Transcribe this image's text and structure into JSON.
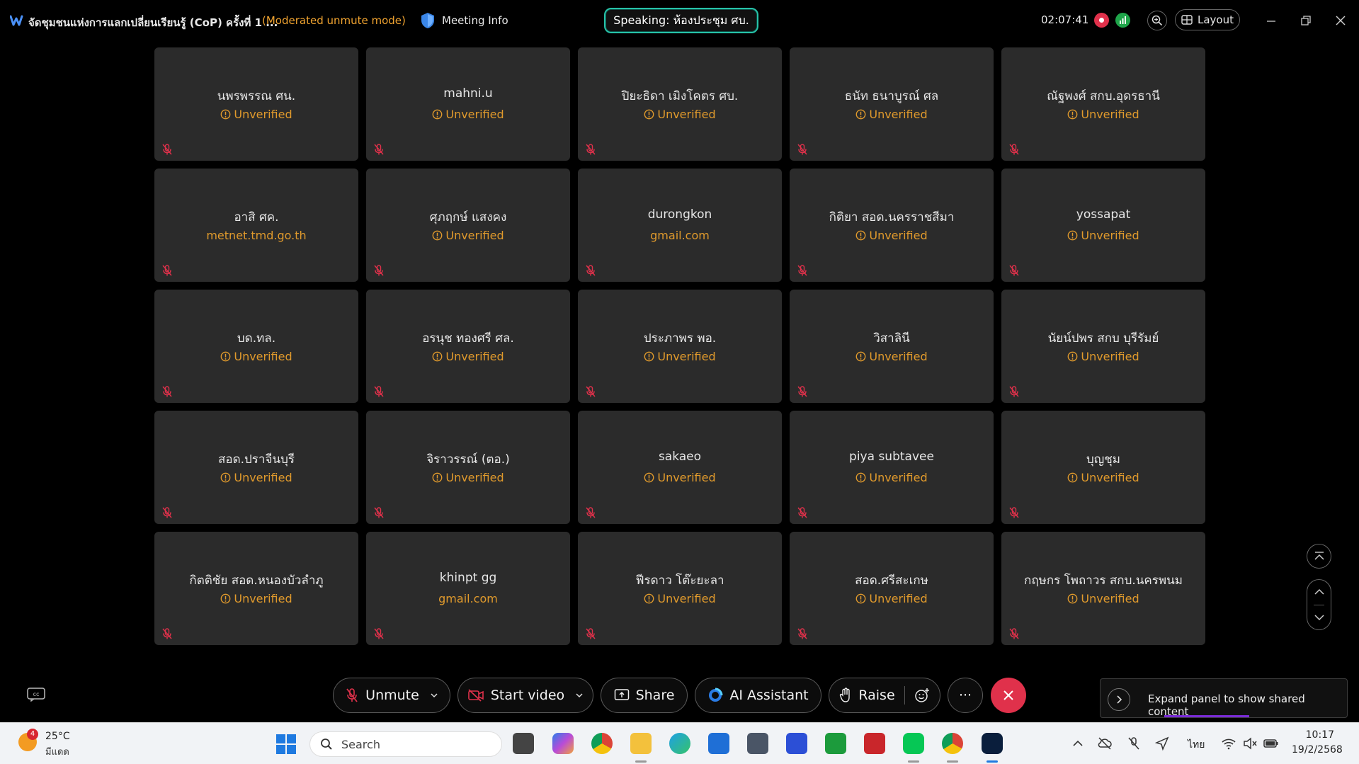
{
  "titlebar": {
    "meeting_title": "จัดชุมชนแห่งการแลกเปลี่ยนเรียนรู้ (CoP) ครั้งที่ 1 ...",
    "moderated": "(Moderated unmute mode)",
    "meeting_info": "Meeting Info",
    "speaking": "Speaking: ห้องประชุม ศบ.",
    "clock": "02:07:41",
    "layout": "Layout"
  },
  "participants": [
    {
      "name": "นพรพรรณ ศน.",
      "status": "Unverified",
      "verified_icon": true
    },
    {
      "name": "mahni.u",
      "status": "Unverified",
      "verified_icon": true
    },
    {
      "name": "ปิยะธิดา เมิงโคตร ศบ.",
      "status": "Unverified",
      "verified_icon": true
    },
    {
      "name": "ธนัท ธนาบูรณ์ ศล",
      "status": "Unverified",
      "verified_icon": true
    },
    {
      "name": "ณัฐพงศ์ สกบ.อุดรธานี",
      "status": "Unverified",
      "verified_icon": true
    },
    {
      "name": "อาสิ ศค.",
      "status": "metnet.tmd.go.th",
      "verified_icon": false
    },
    {
      "name": "ศุภฤกษ์ แสงคง",
      "status": "Unverified",
      "verified_icon": true
    },
    {
      "name": "durongkon",
      "status": "gmail.com",
      "verified_icon": false
    },
    {
      "name": "กิติยา สอด.นครราชสีมา",
      "status": "Unverified",
      "verified_icon": true
    },
    {
      "name": "yossapat",
      "status": "Unverified",
      "verified_icon": true
    },
    {
      "name": "บด.ทล.",
      "status": "Unverified",
      "verified_icon": true
    },
    {
      "name": "อรนุช ทองศรี ศล.",
      "status": "Unverified",
      "verified_icon": true
    },
    {
      "name": "ประภาพร พอ.",
      "status": "Unverified",
      "verified_icon": true
    },
    {
      "name": "วิสาลินี",
      "status": "Unverified",
      "verified_icon": true
    },
    {
      "name": "นัยน์ปพร สกบ บุรีรัมย์",
      "status": "Unverified",
      "verified_icon": true
    },
    {
      "name": "สอด.ปราจีนบุรี",
      "status": "Unverified",
      "verified_icon": true
    },
    {
      "name": "จิราวรรณ์ (ตอ.)",
      "status": "Unverified",
      "verified_icon": true
    },
    {
      "name": "sakaeo",
      "status": "Unverified",
      "verified_icon": true
    },
    {
      "name": "piya subtavee",
      "status": "Unverified",
      "verified_icon": true
    },
    {
      "name": "บุญชุม",
      "status": "Unverified",
      "verified_icon": true
    },
    {
      "name": "กิตติชัย สอด.หนองบัวลำภู",
      "status": "Unverified",
      "verified_icon": true
    },
    {
      "name": "khinpt gg",
      "status": "gmail.com",
      "verified_icon": false
    },
    {
      "name": "ฟีรดาว โต๊ะยะลา",
      "status": "Unverified",
      "verified_icon": true
    },
    {
      "name": "สอด.ศรีสะเกษ",
      "status": "Unverified",
      "verified_icon": true
    },
    {
      "name": "กฤษกร โพถาวร สกบ.นครพนม",
      "status": "Unverified",
      "verified_icon": true
    }
  ],
  "controls": {
    "unmute": "Unmute",
    "start_video": "Start video",
    "share": "Share",
    "ai_assistant": "AI Assistant",
    "raise": "Raise",
    "more": "···"
  },
  "expand_panel": "Expand panel to show shared content",
  "taskbar": {
    "weather_badge": "4",
    "temperature": "25°C",
    "weather_desc": "มีแดด",
    "search_placeholder": "Search",
    "language": "ไทย",
    "time": "10:17",
    "date": "19/2/2568"
  },
  "colors": {
    "accent_speaking": "#27c2a8",
    "unverified": "#e09a2c",
    "end_call": "#e0314b",
    "tile_bg": "#2b2b2b"
  }
}
